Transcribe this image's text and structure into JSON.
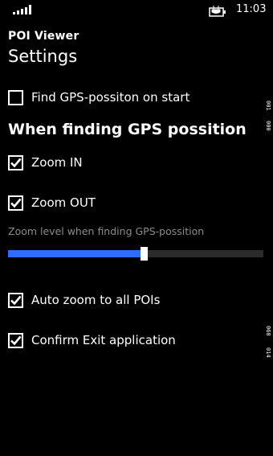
{
  "status_bar": {
    "signal_icon": "signal-strength-icon",
    "battery_icon": "battery-charging-icon",
    "time": "11:03"
  },
  "app": {
    "title": "POI Viewer",
    "page_title": "Settings"
  },
  "settings": {
    "find_gps_on_start": {
      "label": "Find GPS-possiton on start",
      "checked": false
    },
    "section_heading": "When finding GPS possition",
    "zoom_in": {
      "label": "Zoom IN",
      "checked": true
    },
    "zoom_out": {
      "label": "Zoom OUT",
      "checked": true
    },
    "zoom_level": {
      "caption": "Zoom level when finding GPS-possition",
      "value_fraction": 0.53
    },
    "auto_zoom_all_pois": {
      "label": "Auto zoom to all POIs",
      "checked": true
    },
    "confirm_exit": {
      "label": "Confirm Exit application",
      "checked": true
    }
  },
  "edge_labels": {
    "top_a": "001",
    "top_b": "000",
    "bottom_a": "060",
    "bottom_b": "014"
  },
  "colors": {
    "background": "#000000",
    "accent": "#2f6dff",
    "text": "#ffffff",
    "caption": "#8c8c8c"
  }
}
